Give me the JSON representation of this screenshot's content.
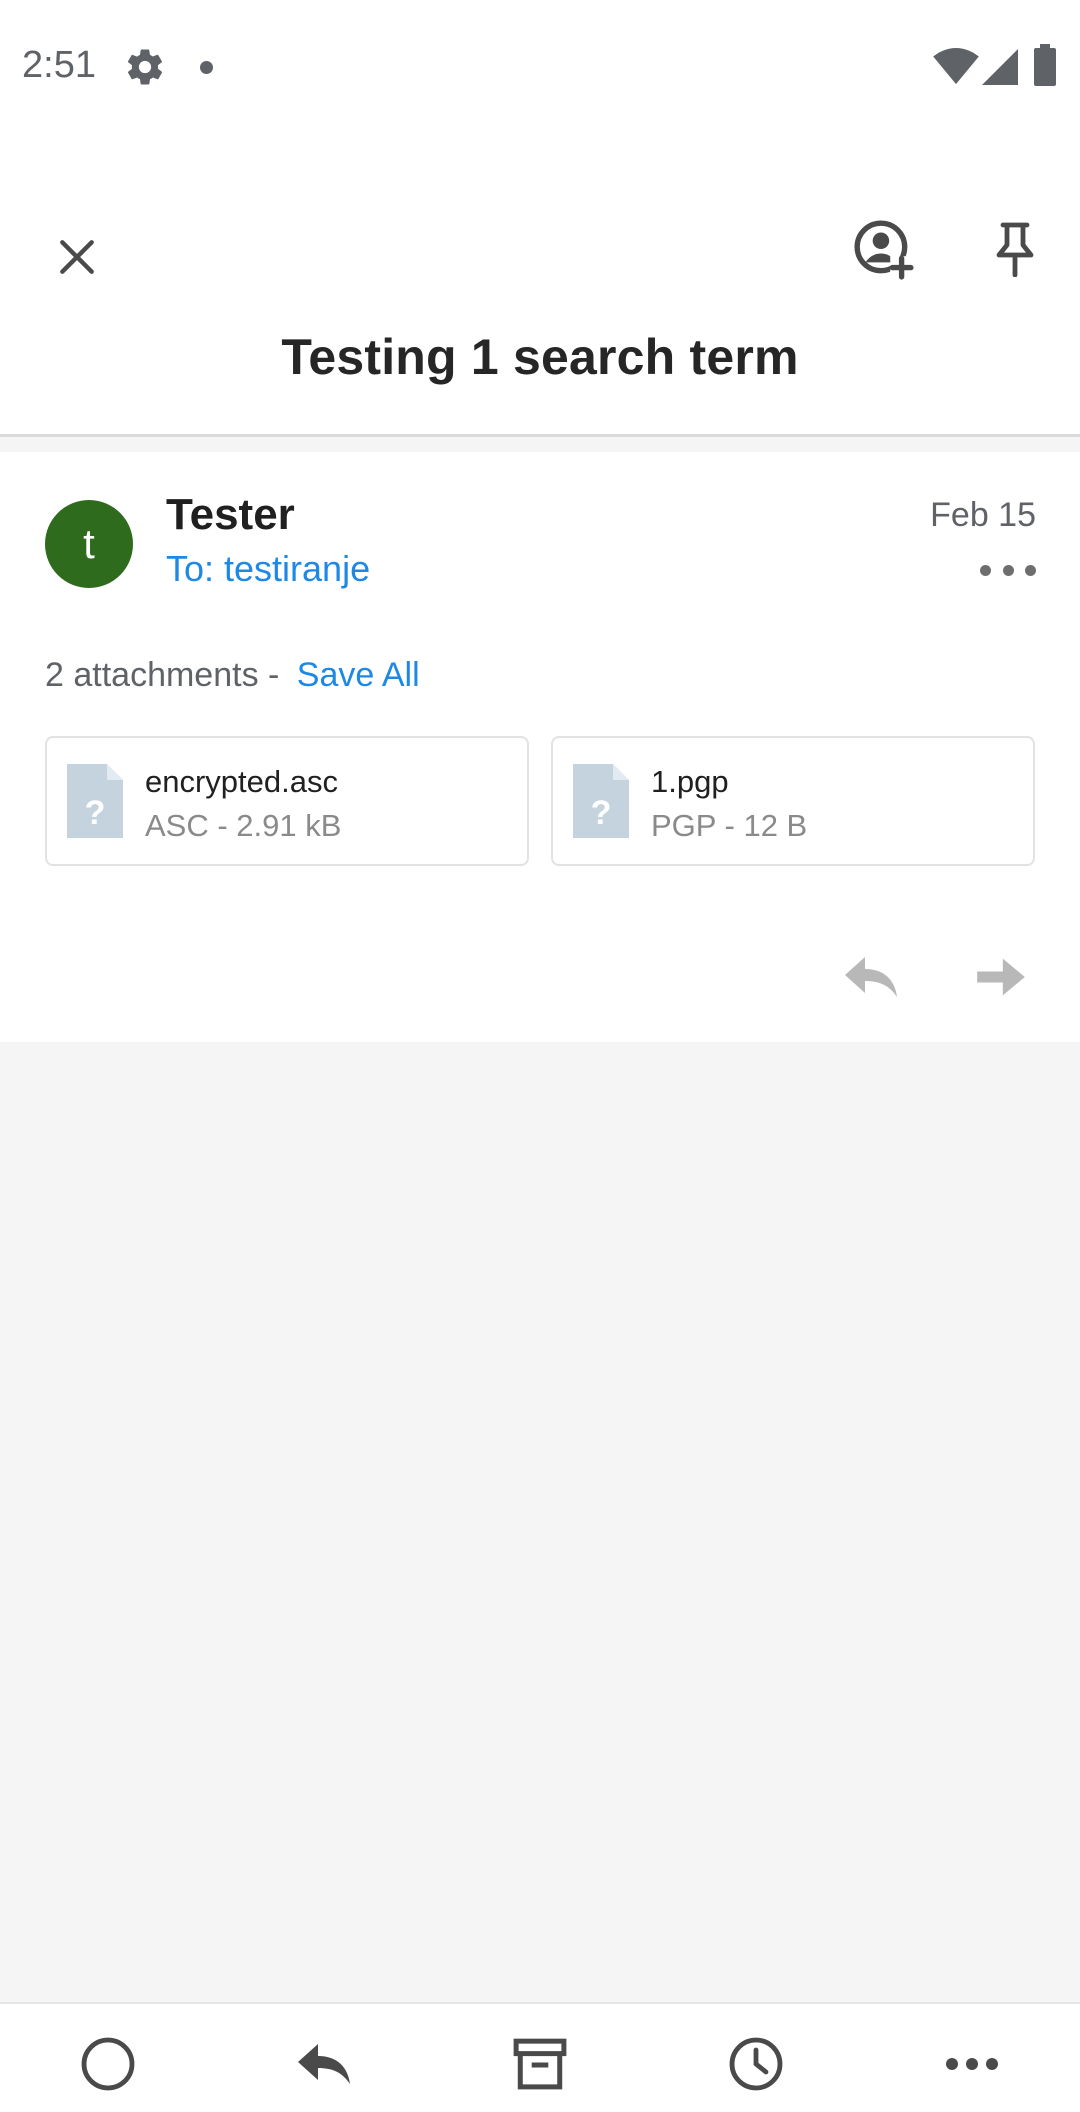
{
  "status_bar": {
    "time": "2:51"
  },
  "message": {
    "subject": "Testing 1 search term",
    "avatar_letter": "t",
    "avatar_color": "#2f6b1d",
    "sender": "Tester",
    "recipient": "To: testiranje",
    "date": "Feb 15",
    "attachments_summary": "2 attachments -",
    "save_all_label": "Save All",
    "attachments": [
      {
        "name": "encrypted.asc",
        "meta": "ASC - 2.91 kB",
        "icon": "unknown-file-icon"
      },
      {
        "name": "1.pgp",
        "meta": "PGP - 12 B",
        "icon": "unknown-file-icon"
      }
    ]
  },
  "icons": {
    "close": "close-icon",
    "add_contact": "add-contact-icon",
    "pin": "pin-icon",
    "more": "more-horizontal-icon",
    "reply": "reply-icon",
    "forward": "forward-icon",
    "bottom_bar": [
      "mark-read-icon",
      "reply-icon",
      "archive-icon",
      "snooze-icon",
      "more-horizontal-icon"
    ]
  },
  "colors": {
    "accent": "#1e88e5",
    "background": "#f5f5f5"
  }
}
